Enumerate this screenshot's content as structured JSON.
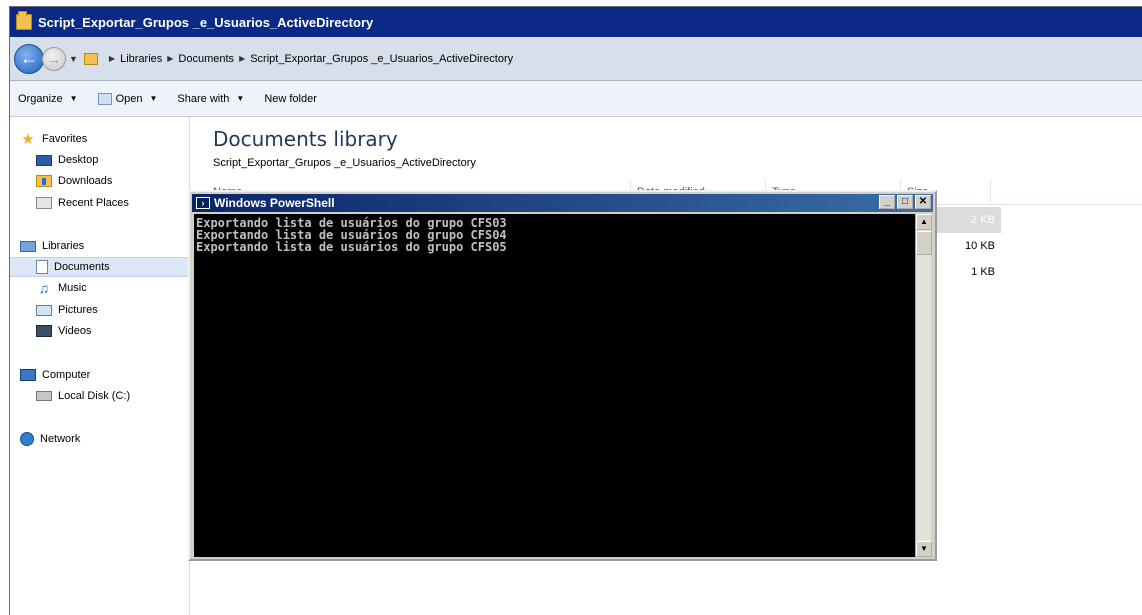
{
  "window": {
    "title": "Script_Exportar_Grupos _e_Usuarios_ActiveDirectory"
  },
  "address": {
    "crumbs": [
      "Libraries",
      "Documents",
      "Script_Exportar_Grupos _e_Usuarios_ActiveDirectory"
    ]
  },
  "toolbar": {
    "organize": "Organize",
    "open": "Open",
    "share_with": "Share with",
    "new_folder": "New folder"
  },
  "nav": {
    "favorites": "Favorites",
    "desktop": "Desktop",
    "downloads": "Downloads",
    "recent_places": "Recent Places",
    "libraries": "Libraries",
    "documents": "Documents",
    "music": "Music",
    "pictures": "Pictures",
    "videos": "Videos",
    "computer": "Computer",
    "local_disk": "Local Disk (C:)",
    "network": "Network"
  },
  "content": {
    "library_title": "Documents library",
    "library_subtitle": "Script_Exportar_Grupos _e_Usuarios_ActiveDirectory",
    "columns": {
      "name": "Name",
      "date_modified": "Date modified",
      "type": "Type",
      "size": "Size"
    },
    "sizes": [
      "2 KB",
      "10 KB",
      "1 KB"
    ]
  },
  "powershell": {
    "title": "Windows PowerShell",
    "lines": [
      "Exportando lista de usuários do grupo CFS03",
      "Exportando lista de usuários do grupo CFS04",
      "Exportando lista de usuários do grupo CFS05"
    ]
  }
}
